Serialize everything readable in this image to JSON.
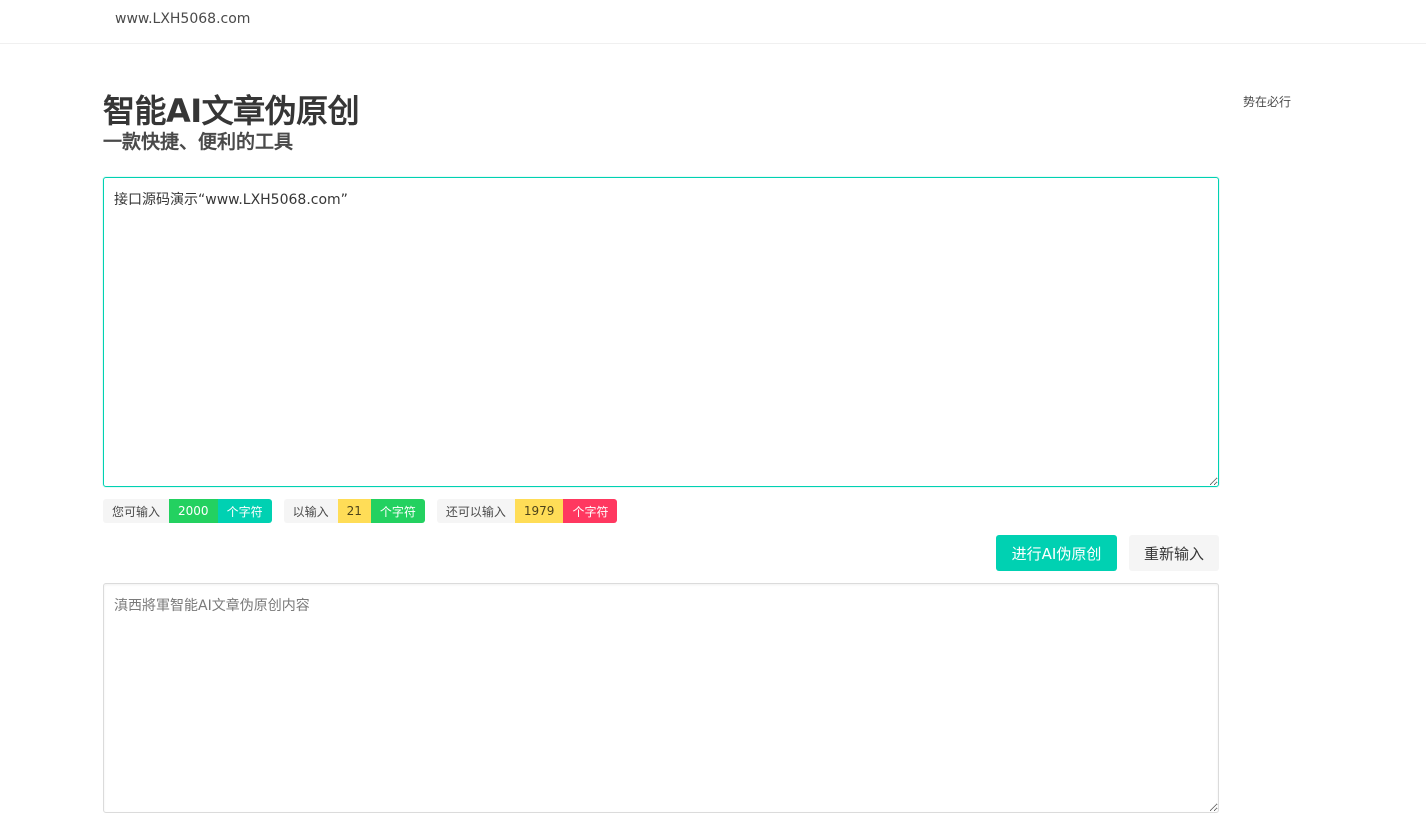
{
  "navbar": {
    "brand": "www.LXH5068.com"
  },
  "side_note": "势在必行",
  "hero": {
    "title": "智能AI文章伪原创",
    "subtitle": "一款快捷、便利的工具"
  },
  "input": {
    "value": "接口源码演示“www.LXH5068.com”"
  },
  "counters": [
    {
      "label": "您可输入",
      "value": "2000",
      "unit": "个字符"
    },
    {
      "label": "以输入",
      "value": "21",
      "unit": "个字符"
    },
    {
      "label": "还可以输入",
      "value": "1979",
      "unit": "个字符"
    }
  ],
  "buttons": {
    "rewrite": "进行AI伪原创",
    "reset": "重新输入"
  },
  "output": {
    "placeholder": "滇西將軍智能AI文章伪原创内容",
    "value": ""
  },
  "colors": {
    "primary": "#00d1b2",
    "success": "#23d160",
    "warning": "#ffdd57",
    "danger": "#ff3860",
    "light": "#f5f5f5"
  }
}
